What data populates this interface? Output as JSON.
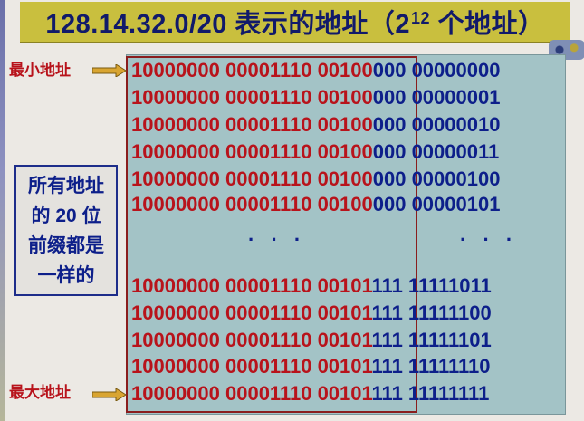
{
  "title": {
    "main": "128.14.32.0/20 表示的地址（2",
    "sup": "12",
    "tail": " 个地址）"
  },
  "labels": {
    "min": "最小地址",
    "max": "最大地址"
  },
  "note": {
    "lines": [
      "所有地址",
      "的 20 位",
      "前缀都是",
      "一样的"
    ]
  },
  "rows": [
    {
      "prefix": "10000000 00001110 00100",
      "host": "000 00000000"
    },
    {
      "prefix": "10000000 00001110 00100",
      "host": "000 00000001"
    },
    {
      "prefix": "10000000 00001110 00100",
      "host": "000 00000010"
    },
    {
      "prefix": "10000000 00001110 00100",
      "host": "000 00000011"
    },
    {
      "prefix": "10000000 00001110 00100",
      "host": "000 00000100"
    },
    {
      "prefix": "10000000 00001110 00100",
      "host": "000 00000101"
    },
    {
      "prefix": "10000000 00001110 00101",
      "host": "111 11111011"
    },
    {
      "prefix": "10000000 00001110 00101",
      "host": "111 11111100"
    },
    {
      "prefix": "10000000 00001110 00101",
      "host": "111 11111101"
    },
    {
      "prefix": "10000000 00001110 00101",
      "host": "111 11111110"
    },
    {
      "prefix": "10000000 00001110 00101",
      "host": "111 11111111"
    }
  ],
  "ellipsis": {
    "left": "· · ·",
    "right": "· · ·"
  },
  "colors": {
    "prefix": "#b8131b",
    "host": "#0d1f8a",
    "title_bg": "#c9bf3e",
    "panel_bg": "#a3c3c6"
  }
}
